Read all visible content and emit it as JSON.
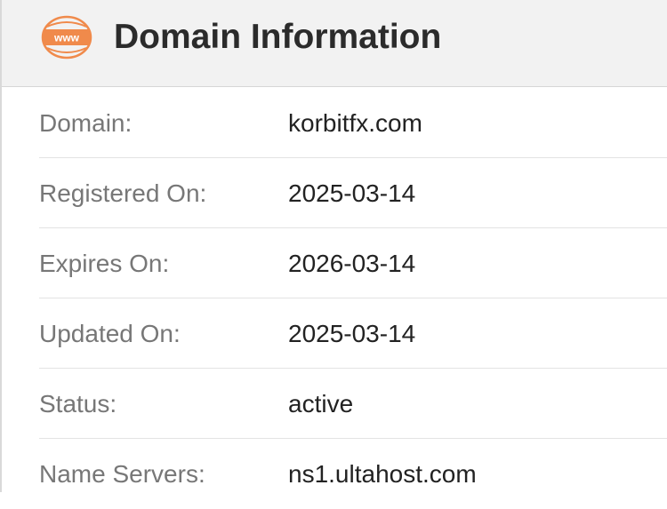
{
  "header": {
    "title": "Domain Information",
    "icon": "www-globe-icon",
    "icon_text": "www",
    "icon_color": "#f08a4b"
  },
  "rows": [
    {
      "label": "Domain:",
      "value": "korbitfx.com"
    },
    {
      "label": "Registered On:",
      "value": "2025-03-14"
    },
    {
      "label": "Expires On:",
      "value": "2026-03-14"
    },
    {
      "label": "Updated On:",
      "value": "2025-03-14"
    },
    {
      "label": "Status:",
      "value": "active"
    },
    {
      "label": "Name Servers:",
      "value": "ns1.ultahost.com"
    }
  ]
}
